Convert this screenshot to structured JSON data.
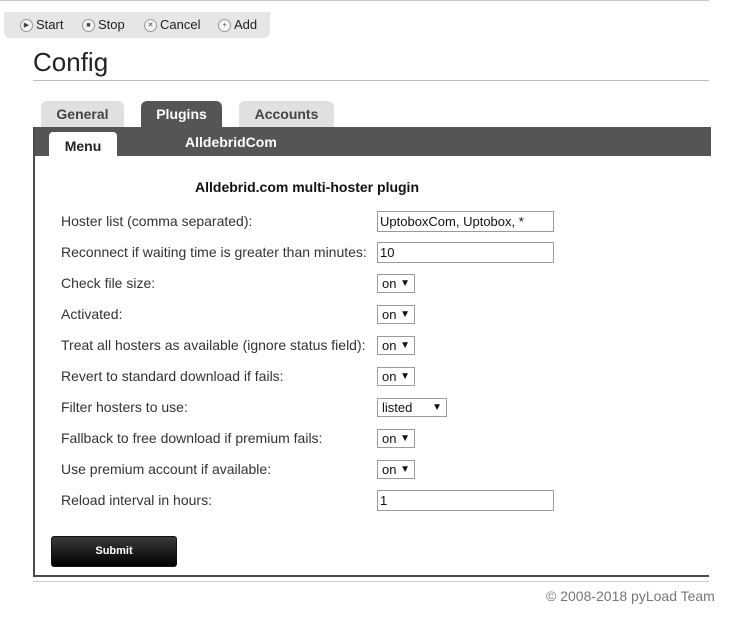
{
  "toolbar": {
    "start_label": "Start",
    "stop_label": "Stop",
    "cancel_label": "Cancel",
    "add_label": "Add"
  },
  "page": {
    "title": "Config"
  },
  "tabs": {
    "general": "General",
    "plugins": "Plugins",
    "accounts": "Accounts",
    "active": "Plugins"
  },
  "subnav": {
    "menu_label": "Menu",
    "current_plugin": "AlldebridCom"
  },
  "plugin": {
    "heading": "Alldebrid.com multi-hoster plugin",
    "fields": {
      "hoster_list": {
        "label": "Hoster list (comma separated):",
        "value": "UptoboxCom, Uptobox, *"
      },
      "reconnect": {
        "label": "Reconnect if waiting time is greater than minutes:",
        "value": "10"
      },
      "check_file_size": {
        "label": "Check file size:",
        "value": "on"
      },
      "activated": {
        "label": "Activated:",
        "value": "on"
      },
      "ignore_status": {
        "label": "Treat all hosters as available (ignore status field):",
        "value": "on"
      },
      "revert_fallback": {
        "label": "Revert to standard download if fails:",
        "value": "on"
      },
      "filter_hosters": {
        "label": "Filter hosters to use:",
        "value": "listed"
      },
      "fallback_free": {
        "label": "Fallback to free download if premium fails:",
        "value": "on"
      },
      "use_premium": {
        "label": "Use premium account if available:",
        "value": "on"
      },
      "reload_interval": {
        "label": "Reload interval in hours:",
        "value": "1"
      }
    },
    "submit_label": "Submit"
  },
  "footer": {
    "copyright": "© 2008-2018 pyLoad Team"
  },
  "colors": {
    "tab_active_bg": "#555555",
    "tab_inactive_bg": "#e0e0e0",
    "submit_bg": "#000000"
  }
}
